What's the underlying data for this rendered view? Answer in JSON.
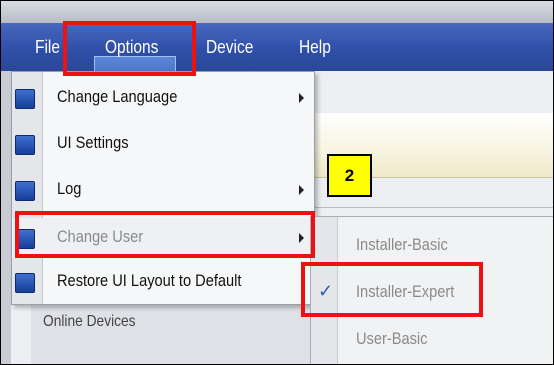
{
  "menubar": {
    "items": [
      {
        "label": "File"
      },
      {
        "label": "Options"
      },
      {
        "label": "Device"
      },
      {
        "label": "Help"
      }
    ]
  },
  "options_menu": {
    "items": [
      {
        "label": "Change Language",
        "icon": "globe-icon",
        "has_submenu": true,
        "enabled": true
      },
      {
        "label": "UI Settings",
        "icon": "wrench-icon",
        "has_submenu": false,
        "enabled": true
      },
      {
        "label": "Log",
        "icon": "wrench-icon",
        "has_submenu": true,
        "enabled": true
      },
      {
        "label": "Change User",
        "icon": "user-icon",
        "has_submenu": true,
        "enabled": false
      },
      {
        "label": "Restore UI Layout to Default",
        "icon": "layout-icon",
        "has_submenu": false,
        "enabled": true
      }
    ]
  },
  "change_user_submenu": {
    "items": [
      {
        "label": "Installer-Basic",
        "checked": false
      },
      {
        "label": "Installer-Expert",
        "checked": true
      },
      {
        "label": "User-Basic",
        "checked": false
      }
    ]
  },
  "background": {
    "panel_label": "Online Devices"
  },
  "annotation": {
    "step_number": "2"
  },
  "colors": {
    "menubar": "#2f4fa8",
    "highlight_box": "#ee1111",
    "badge": "#ffff00",
    "check": "#2f5db8"
  }
}
